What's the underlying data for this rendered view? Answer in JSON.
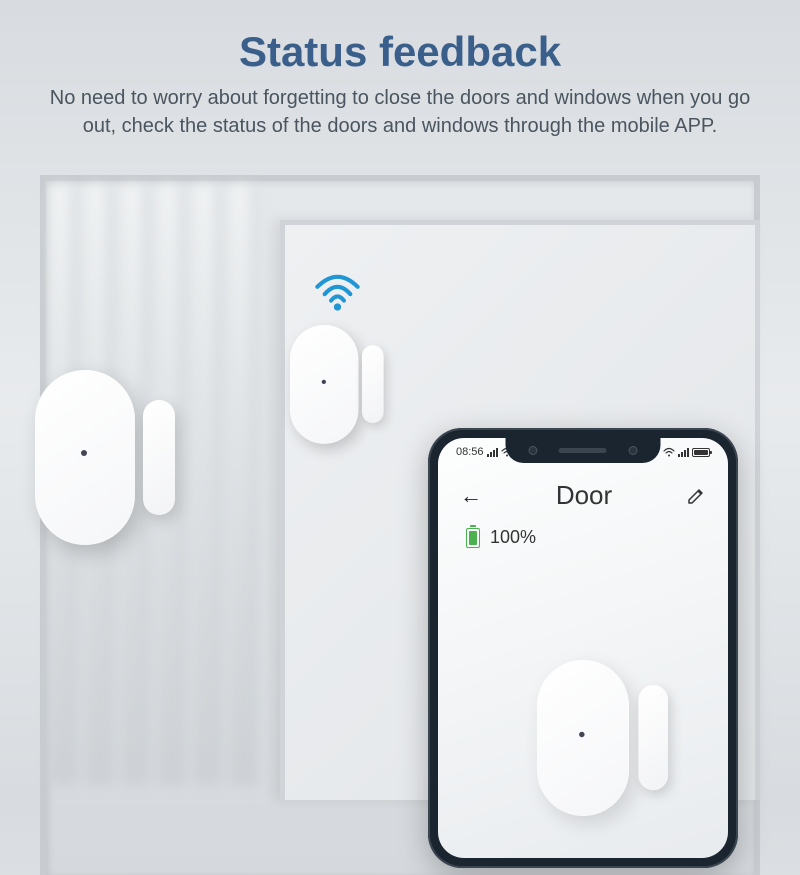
{
  "header": {
    "title": "Status feedback",
    "subtitle": "No need to worry about forgetting to close the doors and windows when you go out, check the status of the doors and windows through the mobile APP."
  },
  "phone": {
    "status_bar": {
      "time": "08:56"
    },
    "app": {
      "title": "Door",
      "battery_level": "100%"
    }
  },
  "colors": {
    "title": "#3a5f8a",
    "wifi": "#2196d4",
    "battery_green": "#4caf50"
  }
}
